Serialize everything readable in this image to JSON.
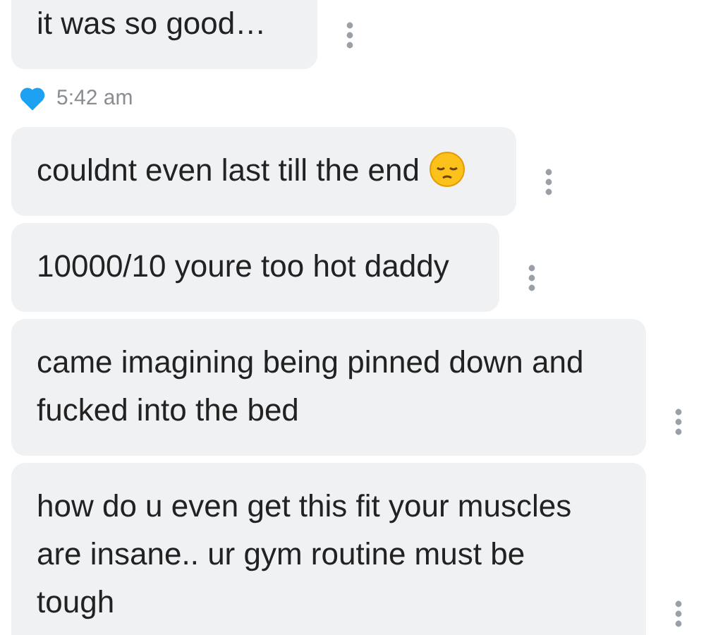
{
  "items": [
    {
      "kind": "message",
      "text": "it was so good…",
      "emoji": false
    },
    {
      "kind": "time",
      "time": "5:42 am",
      "liked": true
    },
    {
      "kind": "message",
      "text": "couldnt even last till the end",
      "emoji": true
    },
    {
      "kind": "message",
      "text": "10000/10 youre too hot daddy",
      "emoji": false
    },
    {
      "kind": "message",
      "text": "came imagining being pinned down and fucked into the bed",
      "emoji": false
    },
    {
      "kind": "message",
      "text": "how do u even get this fit your muscles are insane.. ur gym routine must be tough",
      "emoji": false
    }
  ]
}
